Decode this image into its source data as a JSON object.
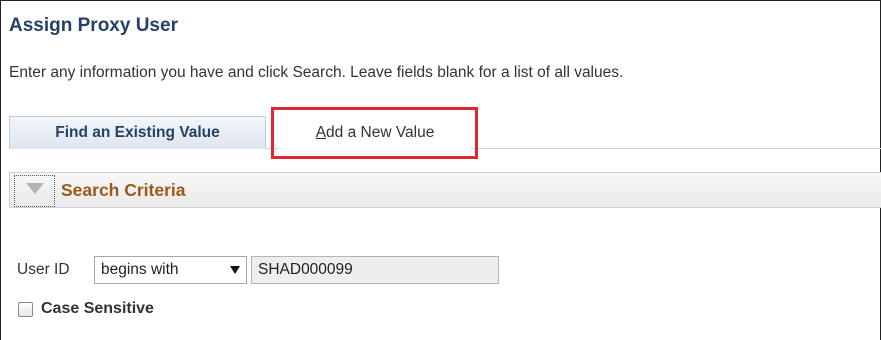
{
  "page": {
    "title": "Assign Proxy User",
    "instructions": "Enter any information you have and click Search. Leave fields blank for a list of all values."
  },
  "tabs": [
    {
      "label_first": "",
      "label_rest": "Find an Existing Value",
      "active": true
    },
    {
      "label_first": "A",
      "label_rest": "dd a New Value",
      "active": false
    }
  ],
  "search_criteria": {
    "title": "Search Criteria",
    "collapse_icon": "triangle-down-icon",
    "fields": {
      "user_id": {
        "label": "User ID",
        "operator": "begins with",
        "value": "SHAD000099"
      }
    },
    "case_sensitive": {
      "label": "Case Sensitive",
      "checked": false
    }
  },
  "colors": {
    "title": "#25406a",
    "criteria_title": "#9c5a1a",
    "highlight": "#e0282e"
  }
}
